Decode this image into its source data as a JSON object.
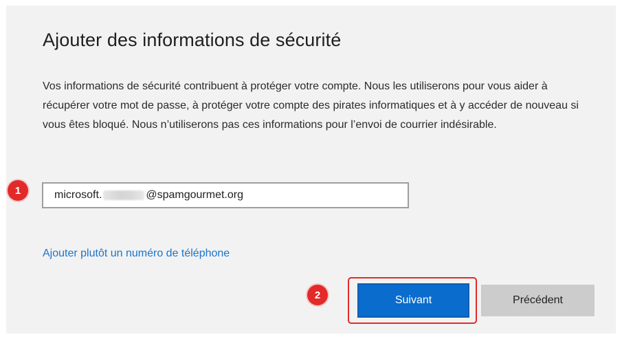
{
  "form": {
    "title": "Ajouter des informations de sécurité",
    "description": "Vos informations de sécurité contribuent à protéger votre compte. Nous les utiliserons pour vous aider à récupérer votre mot de passe, à protéger votre compte des pirates informatiques et à y accéder de nouveau si vous êtes bloqué. Nous n’utiliserons pas ces informations pour l’envoi de courrier indésirable.",
    "email_prefix": "microsoft.",
    "email_suffix": "@spamgourmet.org",
    "phone_link": "Ajouter plutôt un numéro de téléphone",
    "next_label": "Suivant",
    "back_label": "Précédent"
  },
  "annotations": {
    "step_1": "1",
    "step_2": "2"
  },
  "colors": {
    "panel_bg": "#f2f2f2",
    "primary_button": "#0a6ccd",
    "secondary_button": "#cccccc",
    "link": "#1a74cc",
    "annotation_red": "#e22a2a"
  }
}
